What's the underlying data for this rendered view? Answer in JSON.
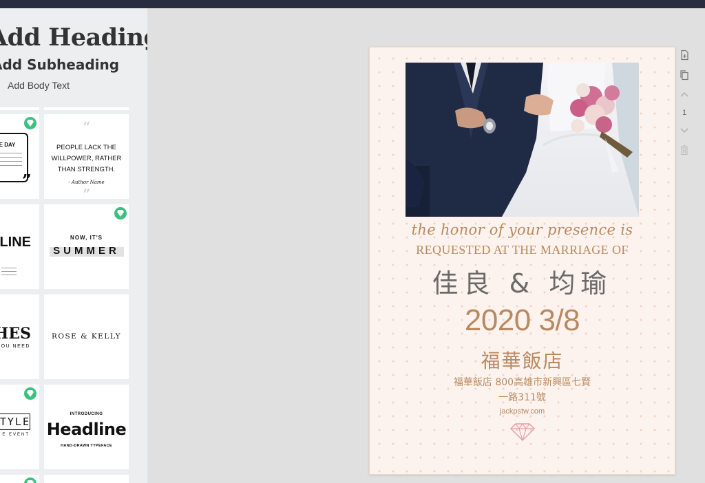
{
  "sidebar": {
    "add_heading": "Add Heading",
    "add_subheading": "Add Subheading",
    "add_body_text": "Add Body Text"
  },
  "templates": {
    "quote": {
      "line1": "PEOPLE LACK THE",
      "line2": "WILLPOWER, RATHER",
      "line3": "THAN STRENGTH.",
      "author": "- Author Name"
    },
    "the_day": "THE DAY",
    "line_text": "LINE",
    "summer_small": "NOW, IT'S",
    "summer": "SUMMER",
    "hes": "HES",
    "you_need": "OU NEED",
    "rose_kelly": "ROSE & KELLY",
    "style": "TYLE",
    "style_sub": "E EVENT",
    "introducing": "INTRODUCING",
    "headline": "Headline",
    "headline_sub": "HAND-DRAWN TYPEFACE"
  },
  "invitation": {
    "script_line": "the honor of your presence is",
    "requested": "REQUESTED AT THE MARRIAGE OF",
    "names": "佳良 & 均瑜",
    "date": "2020 3/8",
    "venue": "福華飯店",
    "address_line1": "福華飯店 800高雄市新興區七賢",
    "address_line2": "一路311號",
    "website": "jackpstw.com"
  },
  "page_controls": {
    "page_number": "1"
  },
  "colors": {
    "accent_gold": "#b98960",
    "premium_badge": "#3cc07d",
    "top_bar": "#2a2c40"
  }
}
